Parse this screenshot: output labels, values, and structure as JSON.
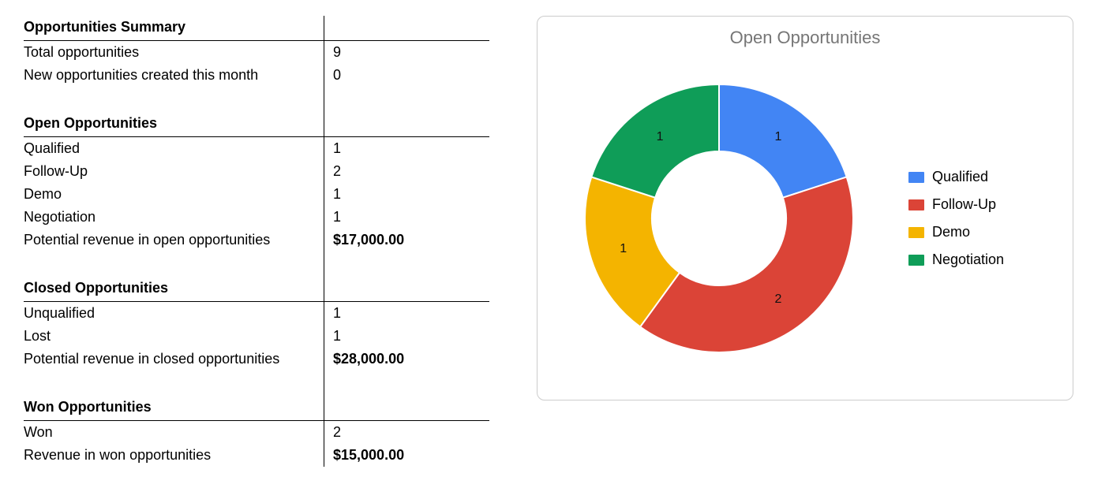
{
  "summary": {
    "heading": "Opportunities Summary",
    "rows": [
      {
        "label": "Total opportunities",
        "value": "9"
      },
      {
        "label": "New opportunities created this month",
        "value": "0"
      }
    ]
  },
  "open": {
    "heading": "Open Opportunities",
    "rows": [
      {
        "label": "Qualified",
        "value": "1"
      },
      {
        "label": "Follow-Up",
        "value": "2"
      },
      {
        "label": "Demo",
        "value": "1"
      },
      {
        "label": "Negotiation",
        "value": "1"
      }
    ],
    "total_row": {
      "label": "Potential revenue in open opportunities",
      "value": "$17,000.00"
    }
  },
  "closed": {
    "heading": "Closed Opportunities",
    "rows": [
      {
        "label": "Unqualified",
        "value": "1"
      },
      {
        "label": "Lost",
        "value": "1"
      }
    ],
    "total_row": {
      "label": "Potential revenue in closed opportunities",
      "value": "$28,000.00"
    }
  },
  "won": {
    "heading": "Won Opportunities",
    "rows": [
      {
        "label": "Won",
        "value": "2"
      }
    ],
    "total_row": {
      "label": "Revenue in won opportunities",
      "value": "$15,000.00"
    }
  },
  "chart_data": {
    "type": "pie",
    "title": "Open Opportunities",
    "donut": true,
    "series": [
      {
        "name": "Qualified",
        "value": 1,
        "color": "#4285F4"
      },
      {
        "name": "Follow-Up",
        "value": 2,
        "color": "#DB4437"
      },
      {
        "name": "Demo",
        "value": 1,
        "color": "#F4B400"
      },
      {
        "name": "Negotiation",
        "value": 1,
        "color": "#0F9D58"
      }
    ],
    "legend_position": "right"
  }
}
